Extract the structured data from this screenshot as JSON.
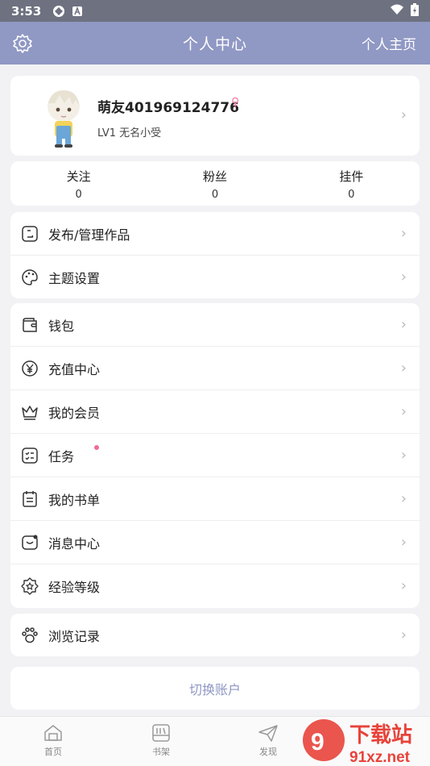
{
  "status_bar": {
    "time": "3:53"
  },
  "header": {
    "title": "个人中心",
    "right_label": "个人主页"
  },
  "profile": {
    "name": "萌友401969124776",
    "gender_symbol": "♀",
    "level": "LV1 无名小受"
  },
  "stats": [
    {
      "label": "关注",
      "value": "0"
    },
    {
      "label": "粉丝",
      "value": "0"
    },
    {
      "label": "挂件",
      "value": "0"
    }
  ],
  "menu_group1": [
    {
      "label": "发布/管理作品",
      "icon": "publish-icon"
    },
    {
      "label": "主题设置",
      "icon": "palette-icon"
    }
  ],
  "menu_group2": [
    {
      "label": "钱包",
      "icon": "wallet-icon"
    },
    {
      "label": "充值中心",
      "icon": "yen-icon"
    },
    {
      "label": "我的会员",
      "icon": "crown-icon"
    },
    {
      "label": "任务",
      "icon": "task-icon"
    },
    {
      "label": "我的书单",
      "icon": "booklist-icon"
    },
    {
      "label": "消息中心",
      "icon": "message-icon"
    },
    {
      "label": "经验等级",
      "icon": "star-badge-icon"
    }
  ],
  "menu_group3": [
    {
      "label": "浏览记录",
      "icon": "paw-icon"
    }
  ],
  "switch_account": "切换账户",
  "tabbar": [
    {
      "label": "首页",
      "icon": "home-icon"
    },
    {
      "label": "书架",
      "icon": "bookshelf-icon"
    },
    {
      "label": "发现",
      "icon": "send-icon"
    }
  ],
  "watermark": {
    "brand": "下载站",
    "site": "91xz.net"
  },
  "colors": {
    "header": "#9098c4",
    "accent_text": "#8f97c6",
    "dot": "#f06a9a",
    "gender": "#f27aa5"
  }
}
